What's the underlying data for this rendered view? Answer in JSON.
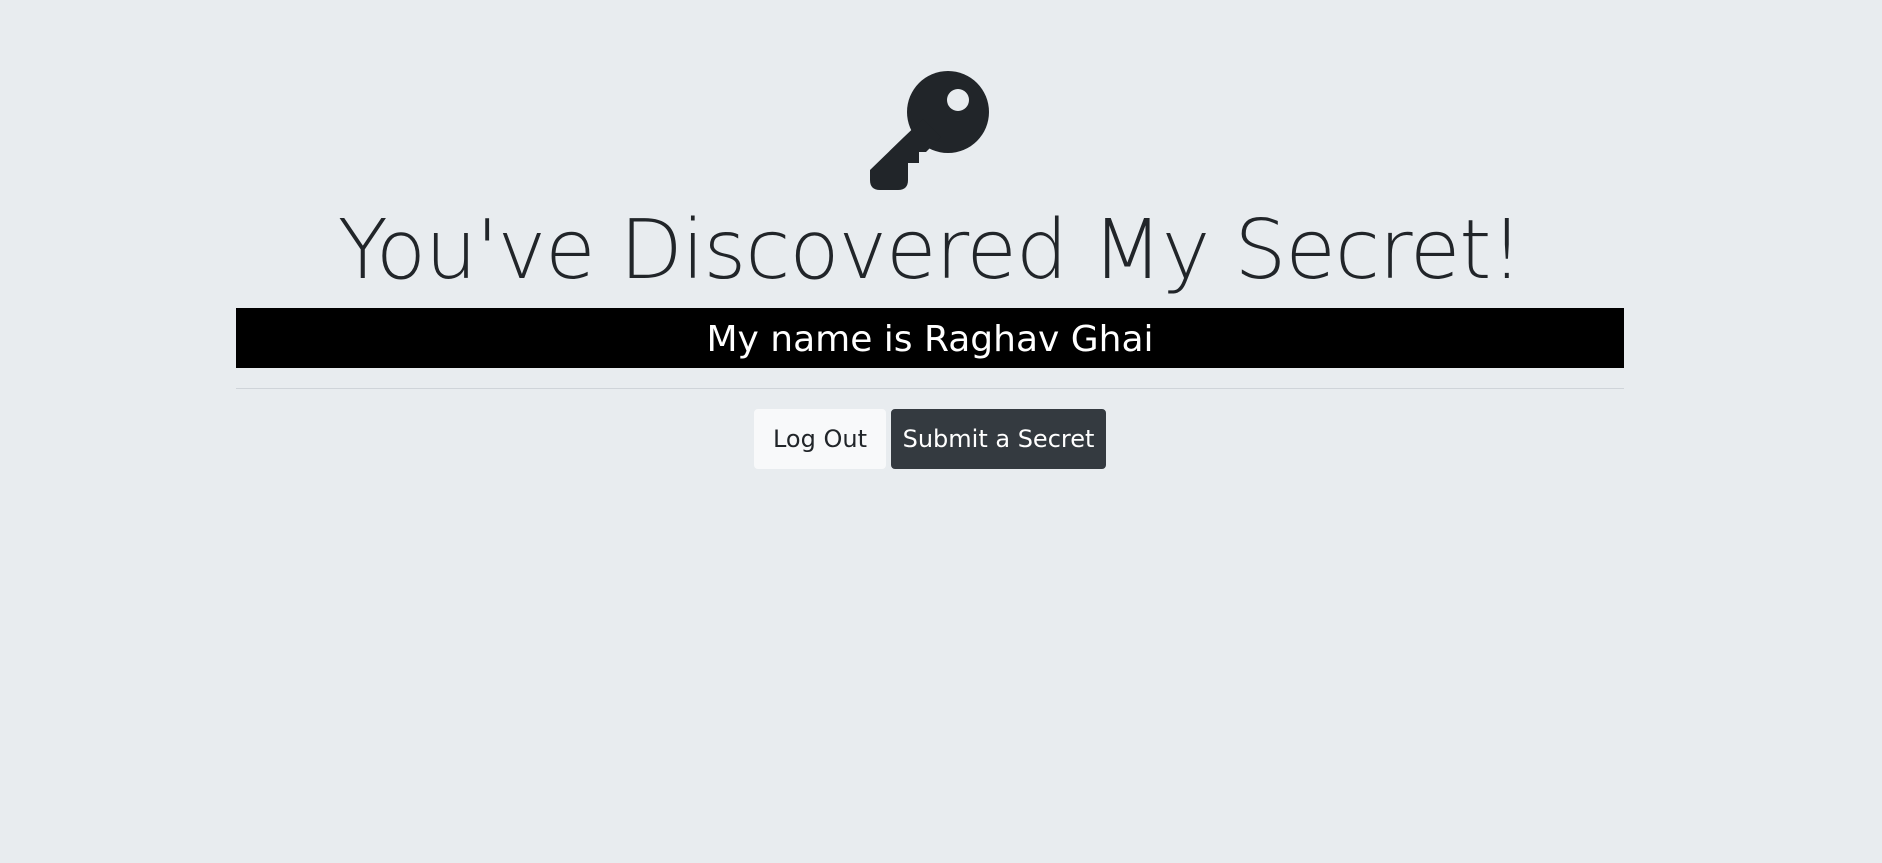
{
  "page": {
    "icon": "key-icon",
    "title": "You've Discovered My Secret!",
    "secret": "My name is Raghav Ghai"
  },
  "actions": {
    "logout_label": "Log Out",
    "submit_label": "Submit a Secret"
  },
  "colors": {
    "background": "#e8ecef",
    "text": "#212529",
    "secret_bar_bg": "#000000",
    "secret_bar_text": "#ffffff",
    "light_button": "#f8f9fa",
    "dark_button": "#343a40"
  }
}
